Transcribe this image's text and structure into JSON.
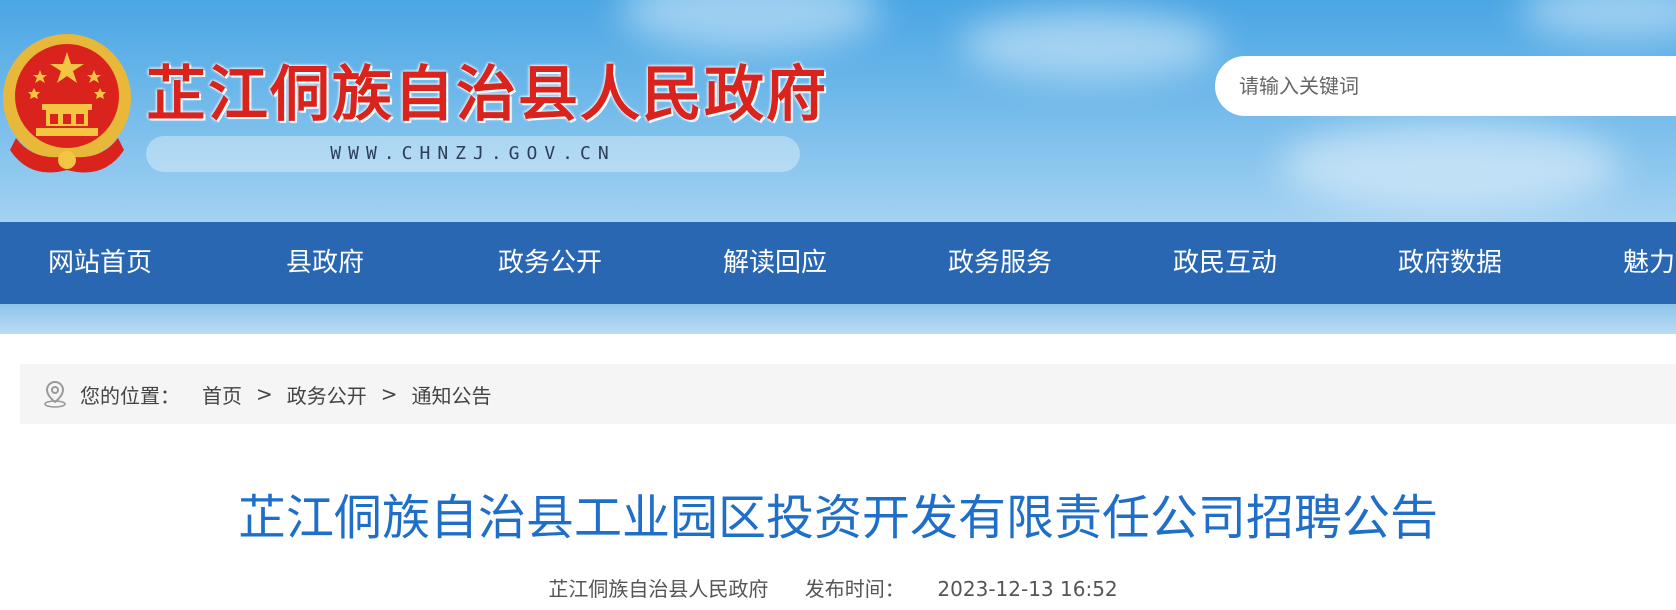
{
  "header": {
    "site_title": "芷江侗族自治县人民政府",
    "domain": "WWW.CHNZJ.GOV.CN",
    "search_placeholder": "请输入关键词"
  },
  "nav": {
    "items": [
      "网站首页",
      "县政府",
      "政务公开",
      "解读回应",
      "政务服务",
      "政民互动",
      "政府数据",
      "魅力"
    ]
  },
  "breadcrumb": {
    "label": "您的位置：",
    "items": [
      "首页",
      "政务公开",
      "通知公告"
    ],
    "separator": ">"
  },
  "article": {
    "title": "芷江侗族自治县工业园区投资开发有限责任公司招聘公告",
    "source": "芷江侗族自治县人民政府",
    "publish_label": "发布时间：",
    "publish_time": "2023-12-13 16:52"
  },
  "colors": {
    "nav_bg": "#2a67b2",
    "title_red": "#d9231c",
    "article_title_blue": "#1f6fc8",
    "breadcrumb_bg": "#f5f5f5"
  }
}
